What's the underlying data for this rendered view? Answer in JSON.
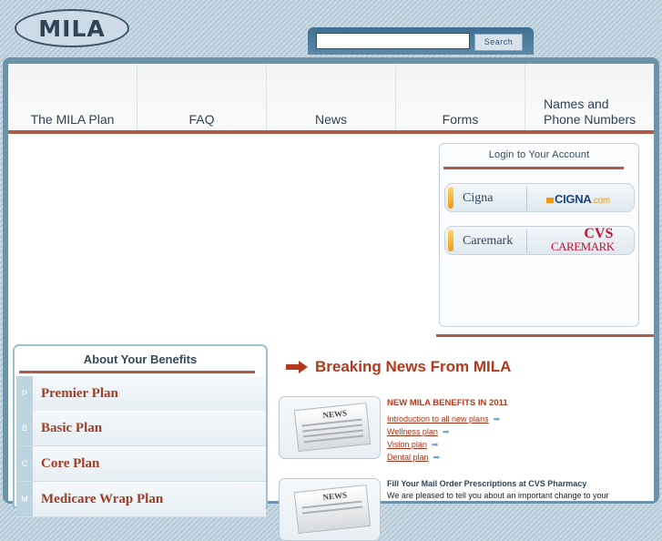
{
  "header": {
    "logo_text": "MILA",
    "search_placeholder": "",
    "search_button": "Search"
  },
  "nav": [
    {
      "label": "The MILA Plan"
    },
    {
      "label": "FAQ"
    },
    {
      "label": "News"
    },
    {
      "label": "Forms"
    },
    {
      "label_line1": "Names and",
      "label_line2": "Phone Numbers"
    }
  ],
  "login": {
    "title": "Login to Your Account",
    "providers": [
      {
        "name": "Cigna",
        "brand": "CIGNA",
        "brand_suffix": ".com"
      },
      {
        "name": "Caremark",
        "brand_top": "CVS",
        "brand_bottom": "CAREMARK"
      }
    ]
  },
  "benefits": {
    "title": "About Your Benefits",
    "items": [
      {
        "letter": "P",
        "label": "Premier Plan"
      },
      {
        "letter": "B",
        "label": "Basic Plan"
      },
      {
        "letter": "C",
        "label": "Core Plan"
      },
      {
        "letter": "M",
        "label": "Medicare Wrap Plan"
      }
    ]
  },
  "news": {
    "heading": "Breaking News From MILA",
    "thumb_label": "NEWS",
    "story1": {
      "title": "NEW MILA BENEFITS IN 2011",
      "links": [
        "Introduction to all new plans",
        "Wellness plan",
        "Vision plan",
        "Dental plan"
      ]
    },
    "story2": {
      "title": "Fill Your Mail Order Prescriptions at CVS Pharmacy",
      "text": "We are pleased to tell you about an important change to your"
    }
  },
  "colors": {
    "accent_red": "#b05a45",
    "frame_blue": "#6d93ab",
    "link_red": "#a63318"
  }
}
